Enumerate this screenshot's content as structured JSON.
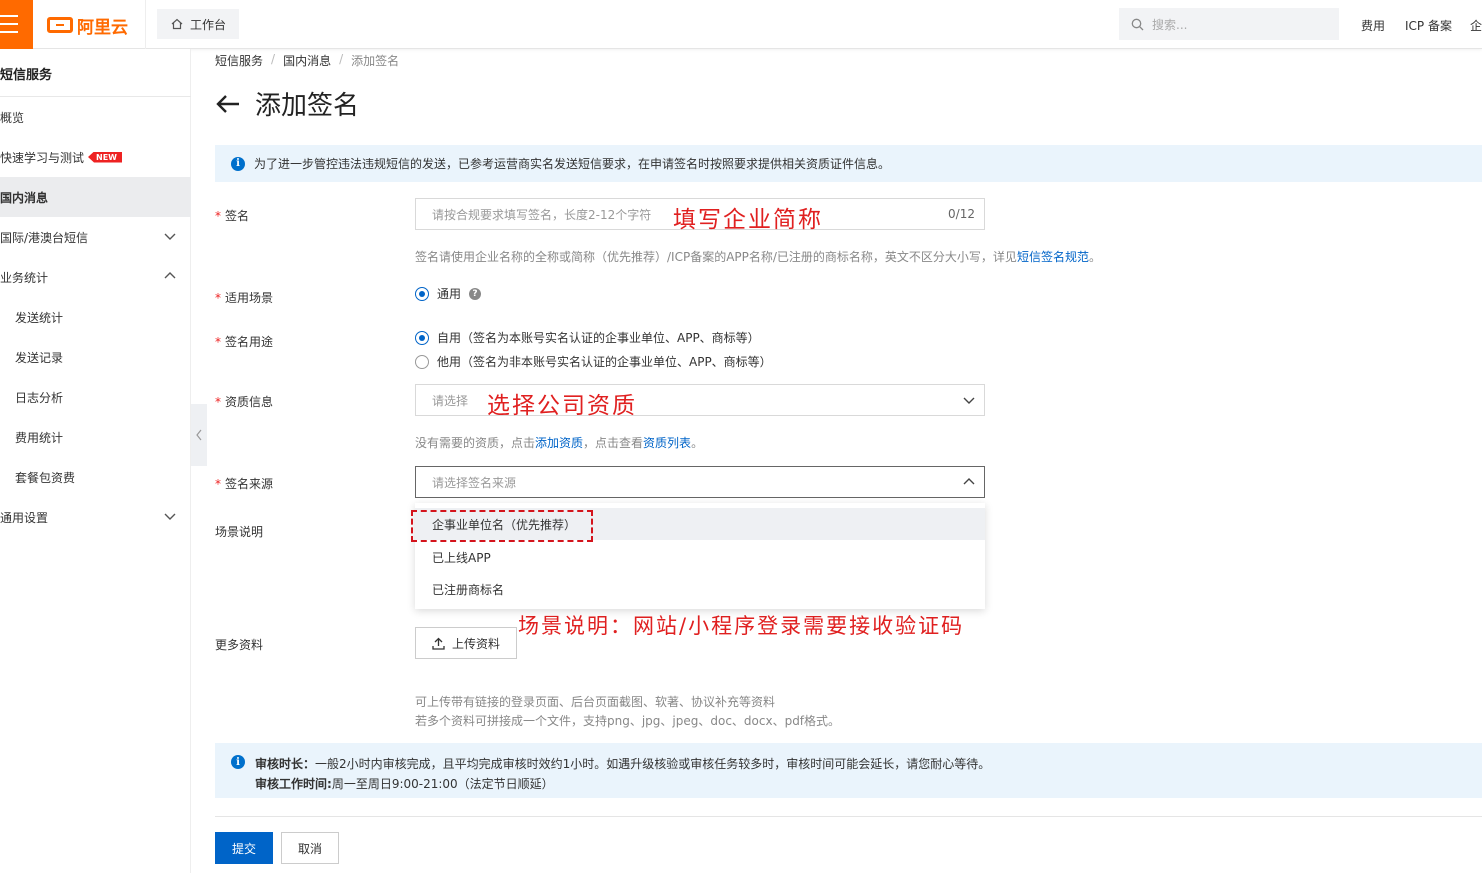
{
  "topbar": {
    "logo_text": "阿里云",
    "workbench": "工作台",
    "search_placeholder": "搜索...",
    "nav": [
      "费用",
      "ICP 备案",
      "企"
    ]
  },
  "sidebar": {
    "title": "短信服务",
    "items": [
      {
        "label": "概览"
      },
      {
        "label": "快速学习与测试",
        "badge": "NEW"
      },
      {
        "label": "国内消息"
      },
      {
        "label": "国际/港澳台短信"
      },
      {
        "label": "业务统计"
      },
      {
        "label": "发送统计"
      },
      {
        "label": "发送记录"
      },
      {
        "label": "日志分析"
      },
      {
        "label": "费用统计"
      },
      {
        "label": "套餐包资费"
      },
      {
        "label": "通用设置"
      }
    ]
  },
  "breadcrumb": [
    "短信服务",
    "国内消息",
    "添加签名"
  ],
  "page_title": "添加签名",
  "top_notice": "为了进一步管控违法违规短信的发送，已参考运营商实名发送短信要求，在申请签名时按照要求提供相关资质证件信息。",
  "form": {
    "signature": {
      "label": "签名",
      "placeholder": "请按合规要求填写签名，长度2-12个字符",
      "counter": "0/12",
      "hint_prefix": "签名请使用企业名称的全称或简称（优先推荐）/ICP备案的APP名称/已注册的商标名称，英文不区分大小写，详见",
      "hint_link": "短信签名规范",
      "hint_suffix": "。"
    },
    "scene": {
      "label": "适用场景",
      "option": "通用"
    },
    "purpose": {
      "label": "签名用途",
      "options": [
        "自用（签名为本账号实名认证的企事业单位、APP、商标等）",
        "他用（签名为非本账号实名认证的企事业单位、APP、商标等）"
      ],
      "selected": 0
    },
    "qualification": {
      "label": "资质信息",
      "placeholder": "请选择",
      "hint_1": "没有需要的资质，点击",
      "hint_link_1": "添加资质",
      "hint_2": "，点击查看",
      "hint_link_2": "资质列表",
      "hint_3": "。"
    },
    "source": {
      "label": "签名来源",
      "placeholder": "请选择签名来源",
      "options": [
        "企事业单位名（优先推荐）",
        "已上线APP",
        "已注册商标名"
      ]
    },
    "scene_desc": {
      "label": "场景说明"
    },
    "more": {
      "label": "更多资料",
      "upload_label": "上传资料",
      "hint_1": "可上传带有链接的登录页面、后台页面截图、软著、协议补充等资料",
      "hint_2": "若多个资料可拼接成一个文件，支持png、jpg、jpeg、doc、docx、pdf格式。"
    }
  },
  "review_notice": {
    "line1_bold": "审核时长：",
    "line1": "一般2小时内审核完成，且平均完成审核时效约1小时。如遇升级核验或审核任务较多时，审核时间可能会延长，请您耐心等待。",
    "line2_bold": "审核工作时间:",
    "line2": "周一至周日9:00-21:00（法定节日顺延）"
  },
  "buttons": {
    "submit": "提交",
    "cancel": "取消"
  },
  "annotations": {
    "signature": "填写企业简称",
    "qualification": "选择公司资质",
    "scene": "场景说明：网站/小程序登录需要接收验证码"
  },
  "colors": {
    "brand": "#ff6a00",
    "primary": "#0064c8",
    "annotation": "#e02020",
    "notice_bg": "#eaf4fc"
  }
}
